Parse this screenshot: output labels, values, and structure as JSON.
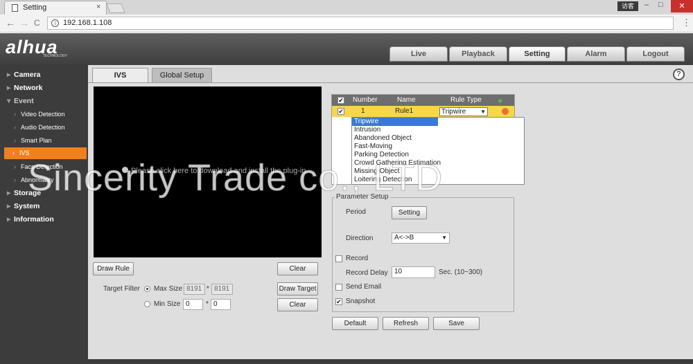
{
  "browser": {
    "tab_title": "Setting",
    "tab_close": "×",
    "user_badge": "访客",
    "win_min": "–",
    "win_max": "□",
    "win_close": "✕",
    "back": "←",
    "forward": "→",
    "reload": "C",
    "url": "192.168.1.108",
    "menu": "⋮"
  },
  "app": {
    "logo": "alhua",
    "logo_sub": "TECHNOLOGY",
    "nav_tabs": [
      "Live",
      "Playback",
      "Setting",
      "Alarm",
      "Logout"
    ],
    "help": "?"
  },
  "sidebar": {
    "camera": "Camera",
    "network": "Network",
    "event": "Event",
    "video_detection": "Video Detection",
    "audio_detection": "Audio Detection",
    "smart_plan": "Smart Plan",
    "ivs": "IVS",
    "face_detection": "Face Detection",
    "abnormality": "Abnormality",
    "storage": "Storage",
    "system": "System",
    "information": "Information"
  },
  "subtabs": {
    "ivs": "IVS",
    "global": "Global Setup"
  },
  "video": {
    "plugin_message": "Please click here to download and install the plug-in."
  },
  "left_controls": {
    "draw_rule": "Draw Rule",
    "clear1": "Clear",
    "target_filter": "Target Filter",
    "max_size": "Max Size",
    "max_w": "8191",
    "max_h": "8191",
    "min_size": "Min Size",
    "min_w": "0",
    "min_h": "0",
    "times": "*",
    "draw_target": "Draw Target",
    "clear2": "Clear"
  },
  "rule_table": {
    "headers": {
      "number": "Number",
      "name": "Name",
      "rule_type": "Rule Type"
    },
    "add": "+",
    "row": {
      "number": "1",
      "name": "Rule1",
      "type": "Tripwire"
    }
  },
  "rule_type_options": [
    "Tripwire",
    "Intrusion",
    "Abandoned Object",
    "Fast-Moving",
    "Parking Detection",
    "Crowd Gathering Estimation",
    "Missing Object",
    "Loitering Detection"
  ],
  "params": {
    "title": "Parameter Setup",
    "period": "Period",
    "setting": "Setting",
    "direction": "Direction",
    "direction_value": "A<->B",
    "record": "Record",
    "record_delay": "Record Delay",
    "record_delay_value": "10",
    "record_delay_unit": "Sec. (10~300)",
    "send_email": "Send Email",
    "snapshot": "Snapshot",
    "snapshot_checked": "✔"
  },
  "footer_buttons": {
    "default": "Default",
    "refresh": "Refresh",
    "save": "Save"
  },
  "watermark": "Sincerity Trade co., LTD",
  "colors": {
    "accent": "#f0801d",
    "selected_row": "#f7d64a",
    "dropdown_sel": "#3b78d8"
  }
}
